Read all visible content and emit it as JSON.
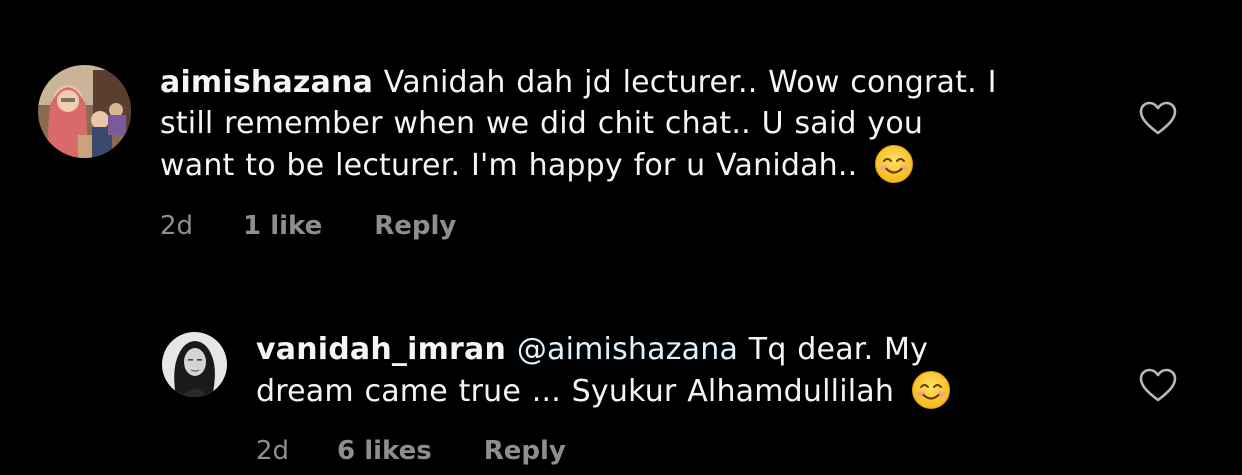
{
  "comments": [
    {
      "username": "aimishazana",
      "text_lines": [
        "Vanidah dah jd lecturer.. Wow congrat. I",
        "still remember when we did chit chat.. U said you",
        "want to be lecturer. I'm happy for u Vanidah.."
      ],
      "emoji": "smiling-face-icon",
      "time": "2d",
      "likes": "1 like",
      "reply_label": "Reply",
      "like_icon": "heart-outline-icon"
    },
    {
      "username": "vanidah_imran",
      "mention": "@aimishazana",
      "text_lines": [
        "Tq dear. My",
        "dream came true ... Syukur Alhamdullilah"
      ],
      "emoji": "smiling-face-icon",
      "time": "2d",
      "likes": "6 likes",
      "reply_label": "Reply",
      "like_icon": "heart-outline-icon"
    }
  ],
  "colors": {
    "background": "#000000",
    "text": "#f5f5f5",
    "meta": "#8e8e8e",
    "heart": "#b8b8b8"
  }
}
